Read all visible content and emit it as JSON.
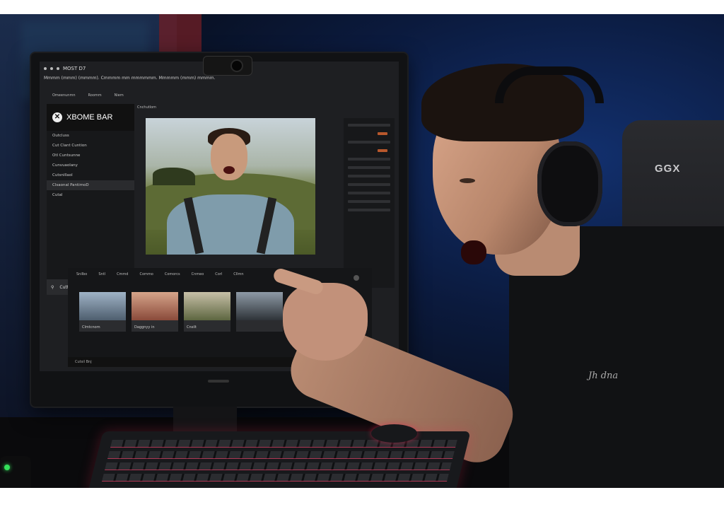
{
  "screen_app": {
    "window_menu_label": "MOST D7",
    "subline": "Mmmm (mmm) (mmmm). Cmmmm mm mmmmmm. Mmmmm (mmm) mmmm.",
    "menu_items": [
      "Omeenunmn",
      "Roomm",
      "Niem"
    ],
    "brand_label": "XBOME BAR",
    "brand_icon": "xbox-logo-icon",
    "sidebar_items": [
      "Outcluss",
      "Cut Clant Cuntion",
      "Otl Cuntsunne",
      "Cunvuaolany",
      "Cutsnillaol",
      "Clsaonal PantimoD",
      "Cutal"
    ],
    "sidebar_search": "Cuttulsanvainl",
    "capture_label": "Cnchutlom",
    "bottom_tabs": [
      "Snilbo",
      "Sntl",
      "Cmmd",
      "Commo",
      "Comorcs",
      "Cnmeo",
      "Corl",
      "Cllmn"
    ],
    "thumbs": [
      "Clmtcnom",
      "Daggnyy in",
      "Cnsilt",
      ""
    ],
    "green_card_label": "P",
    "bottom_bar": "Cutsil Bnj",
    "accent_green": "#21c53a"
  },
  "scene": {
    "chair_logo": "GGX",
    "shirt_print": "Jh dna"
  }
}
